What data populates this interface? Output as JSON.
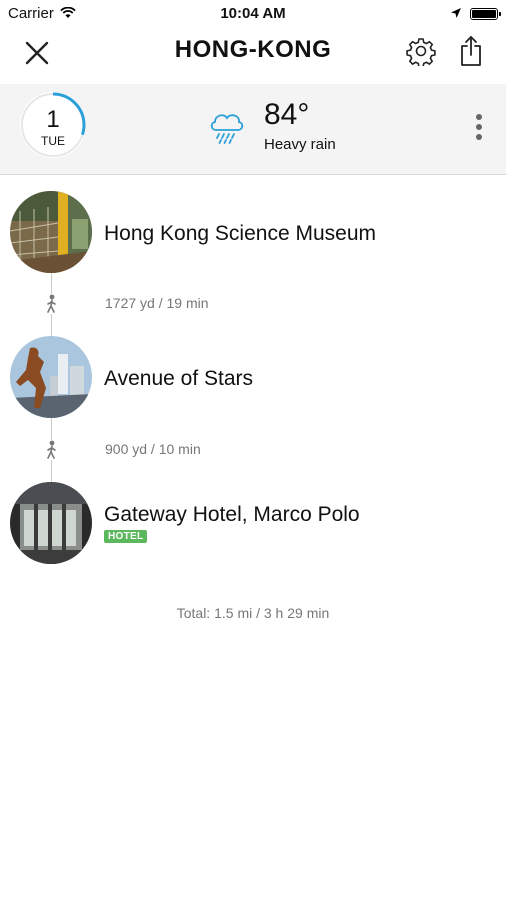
{
  "status": {
    "carrier": "Carrier",
    "time": "10:04 AM"
  },
  "nav": {
    "title": "HONG-KONG"
  },
  "day": {
    "number": "1",
    "weekday": "TUE",
    "progress": 0.3
  },
  "weather": {
    "temp": "84°",
    "condition": "Heavy rain",
    "icon": "heavy-rain-cloud-icon"
  },
  "itinerary": [
    {
      "name": "Hong Kong Science Museum"
    },
    {
      "name": "Avenue of Stars"
    },
    {
      "name": "Gateway Hotel, Marco Polo",
      "badge": "HOTEL"
    }
  ],
  "walks": [
    {
      "distance": "1727 yd / 19 min"
    },
    {
      "distance": "900 yd / 10 min"
    }
  ],
  "total": "Total: 1.5 mi / 3 h 29 min",
  "colors": {
    "accent": "#2a9fd8",
    "hotel": "#5cb85c"
  }
}
